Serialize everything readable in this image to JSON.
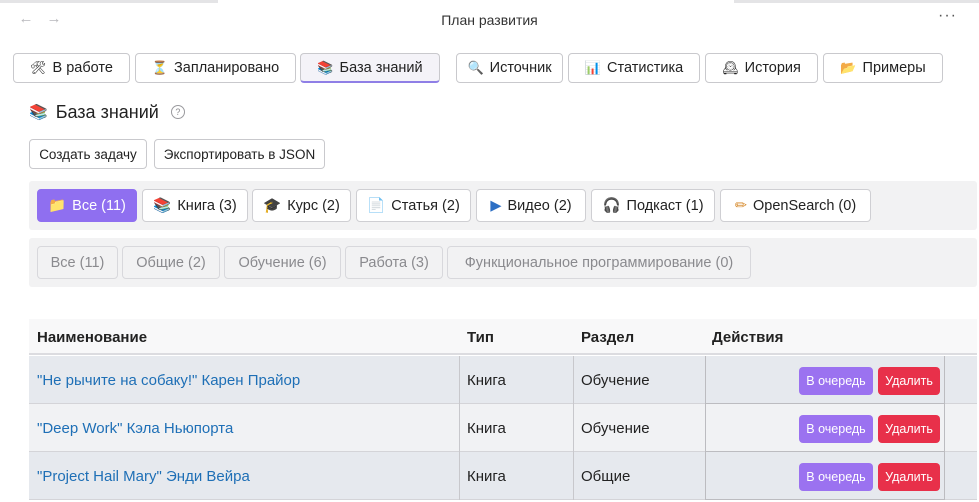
{
  "window": {
    "title": "План развития",
    "more": "···"
  },
  "tabs": [
    {
      "icon": "🛠",
      "label": "В работе",
      "active": false
    },
    {
      "icon": "⏳",
      "label": "Запланировано",
      "active": false
    },
    {
      "icon": "📚",
      "label": "База знаний",
      "active": true
    },
    {
      "icon": "🔍",
      "label": "Источник",
      "active": false
    },
    {
      "icon": "📊",
      "label": "Статистика",
      "active": false
    },
    {
      "icon": "🕰",
      "label": "История",
      "active": false
    },
    {
      "icon": "📂",
      "label": "Примеры",
      "active": false
    }
  ],
  "section": {
    "icon": "📚",
    "title": "База знаний",
    "help": "?"
  },
  "actions": {
    "create": "Создать задачу",
    "export": "Экспортировать в JSON"
  },
  "type_filters": [
    {
      "icon": "📁",
      "label": "Все (11)",
      "active": true
    },
    {
      "icon": "📚",
      "label": "Книга (3)",
      "active": false
    },
    {
      "icon": "🎓",
      "label": "Курс (2)",
      "active": false
    },
    {
      "icon": "📄",
      "label": "Статья (2)",
      "active": false
    },
    {
      "icon": "▶",
      "label": "Видео (2)",
      "active": false
    },
    {
      "icon": "🎧",
      "label": "Подкаст (1)",
      "active": false
    },
    {
      "icon": "✏",
      "label": "OpenSearch (0)",
      "active": false
    }
  ],
  "section_filters": [
    "Все (11)",
    "Общие (2)",
    "Обучение (6)",
    "Работа (3)",
    "Функциональное программирование (0)"
  ],
  "table": {
    "headers": [
      "Наименование",
      "Тип",
      "Раздел",
      "Действия"
    ],
    "rows": [
      {
        "title": "\"Не рычите на собаку!\" Карен Прайор",
        "type": "Книга",
        "section": "Обучение"
      },
      {
        "title": "\"Deep Work\" Кэла Ньюпорта",
        "type": "Книга",
        "section": "Обучение"
      },
      {
        "title": "\"Project Hail Mary\" Энди Вейра",
        "type": "Книга",
        "section": "Общие"
      }
    ],
    "queue_label": "В очередь",
    "delete_label": "Удалить"
  },
  "colors": {
    "accent": "#8f6ff0",
    "danger": "#e8304a",
    "link": "#1e6fb6"
  }
}
